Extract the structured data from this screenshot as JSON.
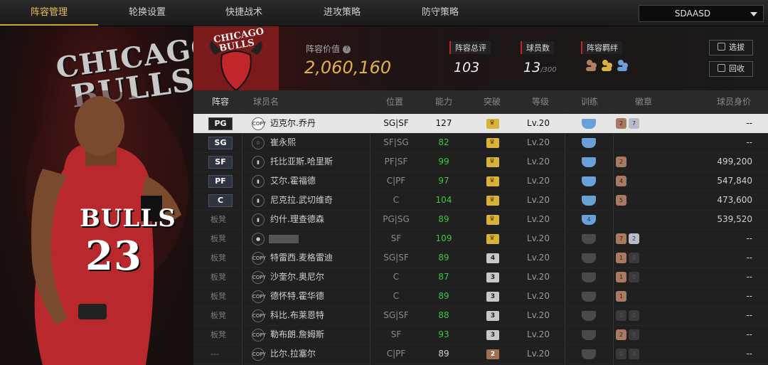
{
  "tabs": [
    "阵容管理",
    "轮换设置",
    "快捷战术",
    "进攻策略",
    "防守策略"
  ],
  "dropdown": {
    "value": "SDAASD"
  },
  "left": {
    "team_text_1": "CHICAGO",
    "team_text_2": "BULLS",
    "jersey_name": "BULLS",
    "jersey_number": "23"
  },
  "header": {
    "logo_text_1": "CHICAGO",
    "logo_text_2": "BULLS",
    "value_label": "阵容价值",
    "value_help": "?",
    "value": "2,060,160",
    "stats": [
      {
        "label": "阵容总评",
        "value": "103",
        "suffix": ""
      },
      {
        "label": "球员数",
        "value": "13",
        "suffix": "/300"
      },
      {
        "label": "阵容羁绊",
        "value": "",
        "suffix": ""
      }
    ],
    "btn_pick": "选拔",
    "btn_recycle": "回收"
  },
  "columns": [
    "阵容",
    "球员名",
    "位置",
    "能力",
    "突破",
    "等级",
    "训练",
    "徽章",
    "球员身价"
  ],
  "rows": [
    {
      "slot": "PG",
      "bench": false,
      "ptype": "COPY",
      "name": "迈克尔.乔丹",
      "position": "SG|SF",
      "ability": "127",
      "green": false,
      "breach": "gold",
      "breach_num": "",
      "level": "Lv.20",
      "train": "blue",
      "train_num": "",
      "badges": [
        [
          "br",
          "2"
        ],
        [
          "sv",
          "7"
        ]
      ],
      "price": "--"
    },
    {
      "slot": "SG",
      "bench": false,
      "ptype": "star",
      "name": "崔永熙",
      "position": "SF|SG",
      "ability": "82",
      "green": true,
      "breach": "gold",
      "breach_num": "",
      "level": "Lv.20",
      "train": "blue",
      "train_num": "",
      "badges": [],
      "price": "--"
    },
    {
      "slot": "SF",
      "bench": false,
      "ptype": "bars",
      "name": "托比亚斯.哈里斯",
      "position": "PF|SF",
      "ability": "99",
      "green": true,
      "breach": "gold",
      "breach_num": "",
      "level": "Lv.20",
      "train": "blue",
      "train_num": "",
      "badges": [
        [
          "br",
          "2"
        ]
      ],
      "price": "499,200"
    },
    {
      "slot": "PF",
      "bench": false,
      "ptype": "bars",
      "name": "艾尔.霍福德",
      "position": "C|PF",
      "ability": "97",
      "green": true,
      "breach": "gold",
      "breach_num": "",
      "level": "Lv.20",
      "train": "blue",
      "train_num": "",
      "badges": [
        [
          "br",
          "4"
        ]
      ],
      "price": "547,840"
    },
    {
      "slot": "C",
      "bench": false,
      "ptype": "bars",
      "name": "尼克拉.武切维奇",
      "position": "C",
      "ability": "104",
      "green": true,
      "breach": "gold",
      "breach_num": "",
      "level": "Lv.20",
      "train": "blue",
      "train_num": "",
      "badges": [
        [
          "br",
          "5"
        ]
      ],
      "price": "473,600"
    },
    {
      "slot": "板凳",
      "bench": true,
      "ptype": "bars",
      "name": "约什.理查德森",
      "position": "PG|SG",
      "ability": "89",
      "green": true,
      "breach": "gold",
      "breach_num": "",
      "level": "Lv.20",
      "train": "blue",
      "train_num": "4",
      "badges": [],
      "price": "539,520"
    },
    {
      "slot": "板凳",
      "bench": true,
      "ptype": "user",
      "name": "",
      "position": "SF",
      "ability": "109",
      "green": true,
      "breach": "gold",
      "breach_num": "",
      "level": "Lv.20",
      "train": "gray",
      "train_num": "",
      "badges": [
        [
          "br",
          "7"
        ],
        [
          "sv",
          "2"
        ]
      ],
      "price": "--"
    },
    {
      "slot": "板凳",
      "bench": true,
      "ptype": "COPY",
      "name": "特雷西.麦格雷迪",
      "position": "SG|SF",
      "ability": "89",
      "green": true,
      "breach": "silver",
      "breach_num": "4",
      "level": "Lv.20",
      "train": "gray",
      "train_num": "",
      "badges": [
        [
          "br",
          "1"
        ],
        [
          "gy",
          "0"
        ]
      ],
      "price": "--"
    },
    {
      "slot": "板凳",
      "bench": true,
      "ptype": "COPY",
      "name": "沙奎尔.奥尼尔",
      "position": "C",
      "ability": "87",
      "green": true,
      "breach": "silver",
      "breach_num": "3",
      "level": "Lv.20",
      "train": "gray",
      "train_num": "",
      "badges": [
        [
          "br",
          "1"
        ],
        [
          "gy",
          "0"
        ]
      ],
      "price": "--"
    },
    {
      "slot": "板凳",
      "bench": true,
      "ptype": "COPY",
      "name": "德怀特.霍华德",
      "position": "C",
      "ability": "89",
      "green": true,
      "breach": "silver",
      "breach_num": "3",
      "level": "Lv.20",
      "train": "gray",
      "train_num": "",
      "badges": [
        [
          "br",
          "1"
        ]
      ],
      "price": "--"
    },
    {
      "slot": "板凳",
      "bench": true,
      "ptype": "COPY",
      "name": "科比.布莱恩特",
      "position": "SG|SF",
      "ability": "88",
      "green": true,
      "breach": "silver",
      "breach_num": "3",
      "level": "Lv.20",
      "train": "gray",
      "train_num": "",
      "badges": [
        [
          "gy",
          "0"
        ],
        [
          "gy",
          "0"
        ]
      ],
      "price": "--"
    },
    {
      "slot": "板凳",
      "bench": true,
      "ptype": "COPY",
      "name": "勒布朗.詹姆斯",
      "position": "SF",
      "ability": "93",
      "green": true,
      "breach": "silver",
      "breach_num": "3",
      "level": "Lv.20",
      "train": "gray",
      "train_num": "",
      "badges": [
        [
          "br",
          "2"
        ],
        [
          "gy",
          "0"
        ]
      ],
      "price": "--"
    },
    {
      "slot": "---",
      "bench": true,
      "ptype": "COPY",
      "name": "比尔.拉塞尔",
      "position": "C|PF",
      "ability": "89",
      "green": false,
      "breach": "bronze",
      "breach_num": "2",
      "level": "Lv.20",
      "train": "gray",
      "train_num": "",
      "badges": [
        [
          "gy",
          "0"
        ],
        [
          "gy",
          "0"
        ]
      ],
      "price": "--"
    }
  ]
}
